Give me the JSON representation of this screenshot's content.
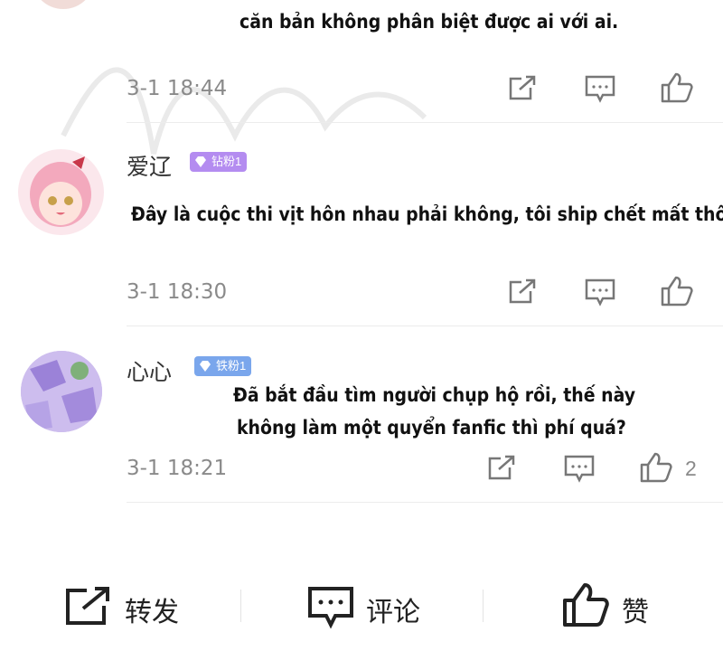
{
  "comments": [
    {
      "text": "căn bản không phân biệt được ai với ai.",
      "time": "3-1 18:44",
      "like_count": ""
    },
    {
      "username": "爱辽",
      "badge": "钻粉1",
      "text": "Đây là cuộc thi vịt hôn nhau phải không, tôi ship chết mất thôi.",
      "time": "3-1 18:30",
      "like_count": ""
    },
    {
      "username": "心心",
      "badge": "铁粉1",
      "text_lines": [
        "Đã bắt đầu tìm người chụp hộ rồi, thế này",
        "không làm một quyển fanfic thì phí quá?"
      ],
      "time": "3-1 18:21",
      "like_count": "2"
    }
  ],
  "bottom_bar": {
    "repost_label": "转发",
    "comment_label": "评论",
    "like_label": "赞"
  },
  "colors": {
    "badge_diamond": "#b48cf0",
    "badge_iron": "#7aa6ec",
    "icon_gray": "#777777",
    "text_time": "#8a8a8a"
  },
  "icons": [
    "share-icon",
    "comment-icon",
    "thumbs-up-icon"
  ]
}
